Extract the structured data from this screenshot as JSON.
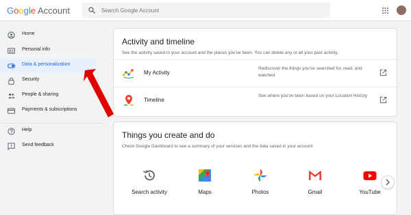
{
  "header": {
    "logo_letters": [
      "G",
      "o",
      "o",
      "g",
      "l",
      "e"
    ],
    "logo_suffix": "Account",
    "search_placeholder": "Search Google Account"
  },
  "sidebar": {
    "items": [
      {
        "label": "Home",
        "icon": "home-icon"
      },
      {
        "label": "Personal info",
        "icon": "id-card-icon"
      },
      {
        "label": "Data & personalization",
        "icon": "toggle-icon",
        "active": true
      },
      {
        "label": "Security",
        "icon": "lock-icon"
      },
      {
        "label": "People & sharing",
        "icon": "people-icon"
      },
      {
        "label": "Payments & subscriptions",
        "icon": "credit-card-icon"
      },
      {
        "label": "Help",
        "icon": "help-icon"
      },
      {
        "label": "Send feedback",
        "icon": "feedback-icon"
      }
    ]
  },
  "activity_card": {
    "title": "Activity and timeline",
    "description": "See the activity saved in your account and the places you've been. You can delete any or all your past activity.",
    "rows": [
      {
        "label": "My Activity",
        "description": "Rediscover the things you've searched for, read, and watched"
      },
      {
        "label": "Timeline",
        "description": "See where you've been based on your Location History"
      }
    ]
  },
  "things_card": {
    "title": "Things you create and do",
    "description": "Check Google Dashboard to see a summary of your services and the data saved in your account",
    "tiles": [
      {
        "label": "Search activity",
        "icon": "history-icon"
      },
      {
        "label": "Maps",
        "icon": "maps-icon"
      },
      {
        "label": "Photos",
        "icon": "photos-icon"
      },
      {
        "label": "Gmail",
        "icon": "gmail-icon"
      },
      {
        "label": "YouTube",
        "icon": "youtube-icon"
      }
    ]
  },
  "colors": {
    "accent": "#1967d2",
    "active_bg": "#e8f0fe",
    "annotation_arrow": "#e00000"
  }
}
